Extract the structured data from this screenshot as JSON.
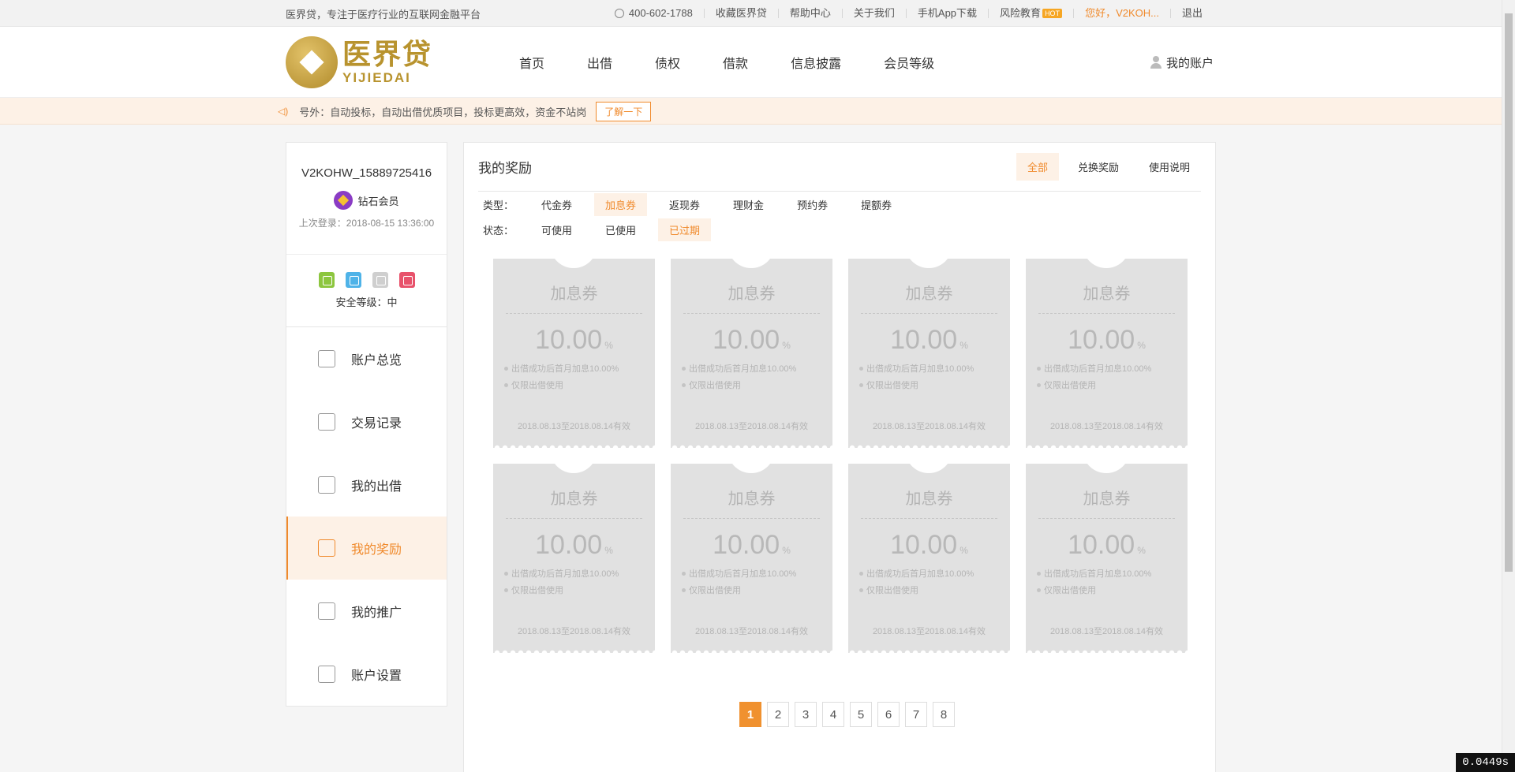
{
  "topbar": {
    "slogan": "医界贷，专注于医疗行业的互联网金融平台",
    "phone": "400-602-1788",
    "links": [
      "收藏医界贷",
      "帮助中心",
      "关于我们",
      "手机App下载"
    ],
    "risk_edu": "风险教育",
    "hot": "HOT",
    "greeting": "您好，V2KOH...",
    "logout": "退出"
  },
  "header": {
    "logo_cn": "医界贷",
    "logo_en": "YIJIEDAI",
    "nav": [
      "首页",
      "出借",
      "债权",
      "借款",
      "信息披露",
      "会员等级"
    ],
    "account": "我的账户"
  },
  "notice": {
    "text": "号外：自动投标，自动出借优质项目，投标更高效，资金不站岗",
    "button": "了解一下"
  },
  "sidebar": {
    "username": "V2KOHW_15889725416",
    "member_level": "钻石会员",
    "last_login": "上次登录：2018-08-15 13:36:00",
    "security_level": "安全等级：中",
    "menu": [
      "账户总览",
      "交易记录",
      "我的出借",
      "我的奖励",
      "我的推广",
      "账户设置"
    ],
    "active_index": 3
  },
  "content": {
    "title": "我的奖励",
    "tabs": [
      "全部",
      "兑换奖励",
      "使用说明"
    ],
    "type_label": "类型：",
    "types": [
      "代金券",
      "加息券",
      "返现券",
      "理财金",
      "预约券",
      "提额券"
    ],
    "status_label": "状态：",
    "statuses": [
      "可使用",
      "已使用",
      "已过期"
    ],
    "coupons": [
      {
        "name": "加息券",
        "rate": "10.00",
        "unit": "%",
        "line1": "出借成功后首月加息10.00%",
        "line2": "仅限出借使用",
        "valid": "2018.08.13至2018.08.14有效"
      },
      {
        "name": "加息券",
        "rate": "10.00",
        "unit": "%",
        "line1": "出借成功后首月加息10.00%",
        "line2": "仅限出借使用",
        "valid": "2018.08.13至2018.08.14有效"
      },
      {
        "name": "加息券",
        "rate": "10.00",
        "unit": "%",
        "line1": "出借成功后首月加息10.00%",
        "line2": "仅限出借使用",
        "valid": "2018.08.13至2018.08.14有效"
      },
      {
        "name": "加息券",
        "rate": "10.00",
        "unit": "%",
        "line1": "出借成功后首月加息10.00%",
        "line2": "仅限出借使用",
        "valid": "2018.08.13至2018.08.14有效"
      },
      {
        "name": "加息券",
        "rate": "10.00",
        "unit": "%",
        "line1": "出借成功后首月加息10.00%",
        "line2": "仅限出借使用",
        "valid": "2018.08.13至2018.08.14有效"
      },
      {
        "name": "加息券",
        "rate": "10.00",
        "unit": "%",
        "line1": "出借成功后首月加息10.00%",
        "line2": "仅限出借使用",
        "valid": "2018.08.13至2018.08.14有效"
      },
      {
        "name": "加息券",
        "rate": "10.00",
        "unit": "%",
        "line1": "出借成功后首月加息10.00%",
        "line2": "仅限出借使用",
        "valid": "2018.08.13至2018.08.14有效"
      },
      {
        "name": "加息券",
        "rate": "10.00",
        "unit": "%",
        "line1": "出借成功后首月加息10.00%",
        "line2": "仅限出借使用",
        "valid": "2018.08.13至2018.08.14有效"
      }
    ],
    "pages": [
      "1",
      "2",
      "3",
      "4",
      "5",
      "6",
      "7",
      "8"
    ],
    "current_page": "1"
  },
  "timer": "0.0449s",
  "colors": {
    "accent": "#f08a2c",
    "gold": "#b8932e",
    "coupon_bg": "#e1e1e1"
  }
}
